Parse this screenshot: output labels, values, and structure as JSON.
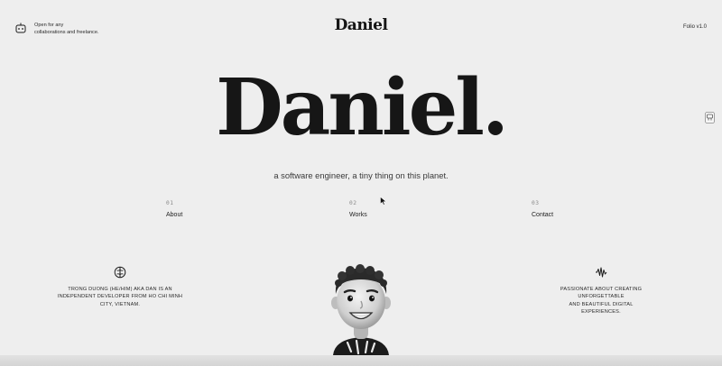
{
  "header": {
    "status_lines": [
      "Open for any",
      "collaborations and freelance."
    ],
    "logo": "Daniel",
    "version": "Folio v1.0"
  },
  "hero": {
    "title": "Daniel.",
    "tagline": "a software engineer, a tiny thing on this planet."
  },
  "nav": [
    {
      "num": "01",
      "label": "About"
    },
    {
      "num": "02",
      "label": "Works"
    },
    {
      "num": "03",
      "label": "Contact"
    }
  ],
  "info": {
    "left": [
      "TRONG DUONG (HE/HIM) AKA DAN IS AN",
      "INDEPENDENT DEVELOPER FROM HO CHI MINH",
      "CITY, VIETNAM."
    ],
    "right": [
      "PASSIONATE ABOUT CREATING UNFORGETTABLE",
      "AND BEAUTIFUL DIGITAL",
      "EXPERIENCES."
    ]
  },
  "icons": {
    "status": "robot-icon",
    "side": "chat-icon",
    "left": "brain-icon",
    "right": "sound-wave-icon"
  },
  "colors": {
    "background": "#eeeeee",
    "text": "#1b1b1b",
    "muted": "#8a8a8a"
  }
}
